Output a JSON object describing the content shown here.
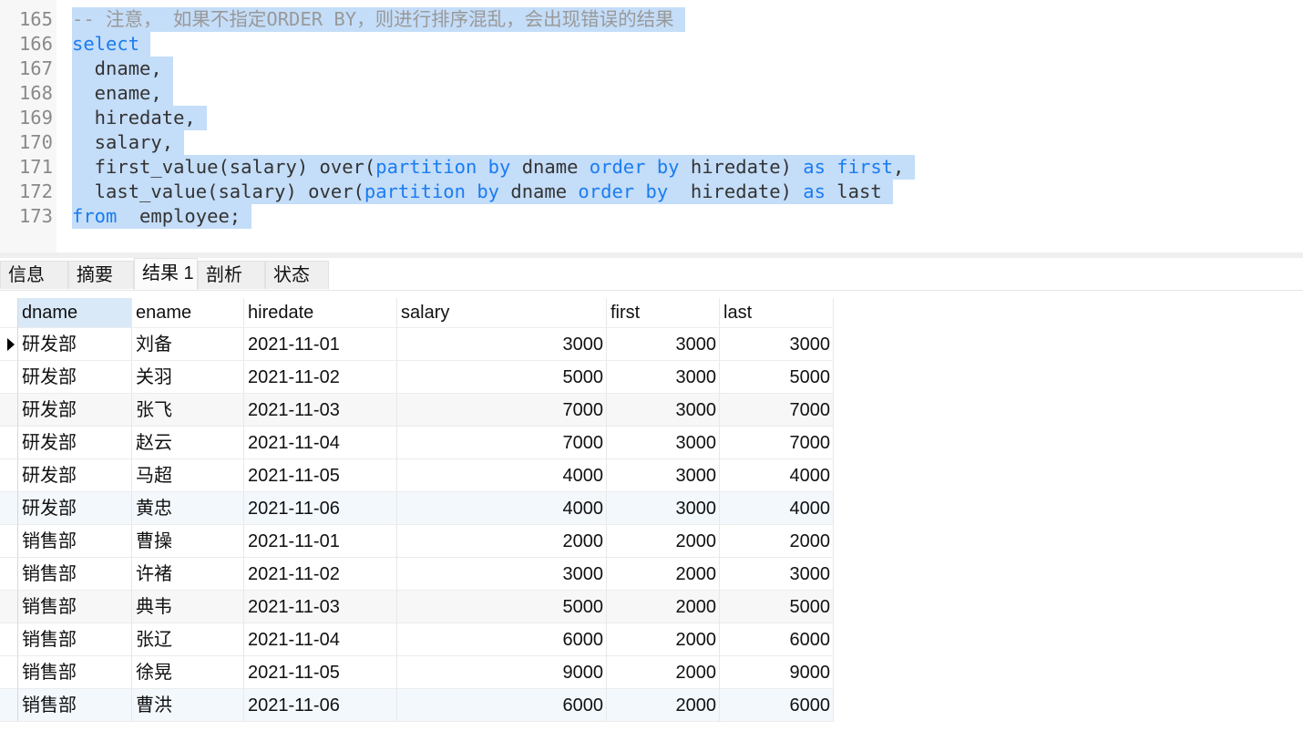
{
  "editor": {
    "lines": [
      {
        "num": "165",
        "tokens": [
          {
            "t": "-- 注意， 如果不指定ORDER BY，则进行排序混乱，会出现错误的结果",
            "k": "cm"
          }
        ]
      },
      {
        "num": "166",
        "tokens": [
          {
            "t": "select",
            "k": "kw"
          }
        ]
      },
      {
        "num": "167",
        "tokens": [
          {
            "t": "  dname,",
            "k": ""
          }
        ]
      },
      {
        "num": "168",
        "tokens": [
          {
            "t": "  ename,",
            "k": ""
          }
        ]
      },
      {
        "num": "169",
        "tokens": [
          {
            "t": "  hiredate,",
            "k": ""
          }
        ]
      },
      {
        "num": "170",
        "tokens": [
          {
            "t": "  salary,",
            "k": ""
          }
        ]
      },
      {
        "num": "171",
        "tokens": [
          {
            "t": "  first_value(salary) over(",
            "k": ""
          },
          {
            "t": "partition by",
            "k": "kw"
          },
          {
            "t": " dname ",
            "k": ""
          },
          {
            "t": "order by",
            "k": "kw"
          },
          {
            "t": " hiredate) ",
            "k": ""
          },
          {
            "t": "as first",
            "k": "kw"
          },
          {
            "t": ",",
            "k": ""
          }
        ]
      },
      {
        "num": "172",
        "tokens": [
          {
            "t": "  last_value(salary) over(",
            "k": ""
          },
          {
            "t": "partition by",
            "k": "kw"
          },
          {
            "t": " dname ",
            "k": ""
          },
          {
            "t": "order by",
            "k": "kw"
          },
          {
            "t": "  hiredate) ",
            "k": ""
          },
          {
            "t": "as",
            "k": "kw"
          },
          {
            "t": " last",
            "k": ""
          }
        ]
      },
      {
        "num": "173",
        "tokens": [
          {
            "t": "from",
            "k": "kw"
          },
          {
            "t": "  employee;",
            "k": ""
          }
        ]
      }
    ]
  },
  "tabs": [
    {
      "label": "信息",
      "active": false
    },
    {
      "label": "摘要",
      "active": false
    },
    {
      "label": "结果 1",
      "active": true
    },
    {
      "label": "剖析",
      "active": false
    },
    {
      "label": "状态",
      "active": false
    }
  ],
  "result": {
    "columns": [
      "dname",
      "ename",
      "hiredate",
      "salary",
      "first",
      "last"
    ],
    "rows": [
      [
        "研发部",
        "刘备",
        "2021-11-01",
        "3000",
        "3000",
        "3000"
      ],
      [
        "研发部",
        "关羽",
        "2021-11-02",
        "5000",
        "3000",
        "5000"
      ],
      [
        "研发部",
        "张飞",
        "2021-11-03",
        "7000",
        "3000",
        "7000"
      ],
      [
        "研发部",
        "赵云",
        "2021-11-04",
        "7000",
        "3000",
        "7000"
      ],
      [
        "研发部",
        "马超",
        "2021-11-05",
        "4000",
        "3000",
        "4000"
      ],
      [
        "研发部",
        "黄忠",
        "2021-11-06",
        "4000",
        "3000",
        "4000"
      ],
      [
        "销售部",
        "曹操",
        "2021-11-01",
        "2000",
        "2000",
        "2000"
      ],
      [
        "销售部",
        "许褚",
        "2021-11-02",
        "3000",
        "2000",
        "3000"
      ],
      [
        "销售部",
        "典韦",
        "2021-11-03",
        "5000",
        "2000",
        "5000"
      ],
      [
        "销售部",
        "张辽",
        "2021-11-04",
        "6000",
        "2000",
        "6000"
      ],
      [
        "销售部",
        "徐晃",
        "2021-11-05",
        "9000",
        "2000",
        "9000"
      ],
      [
        "销售部",
        "曹洪",
        "2021-11-06",
        "6000",
        "2000",
        "6000"
      ]
    ],
    "current_row": 0
  }
}
